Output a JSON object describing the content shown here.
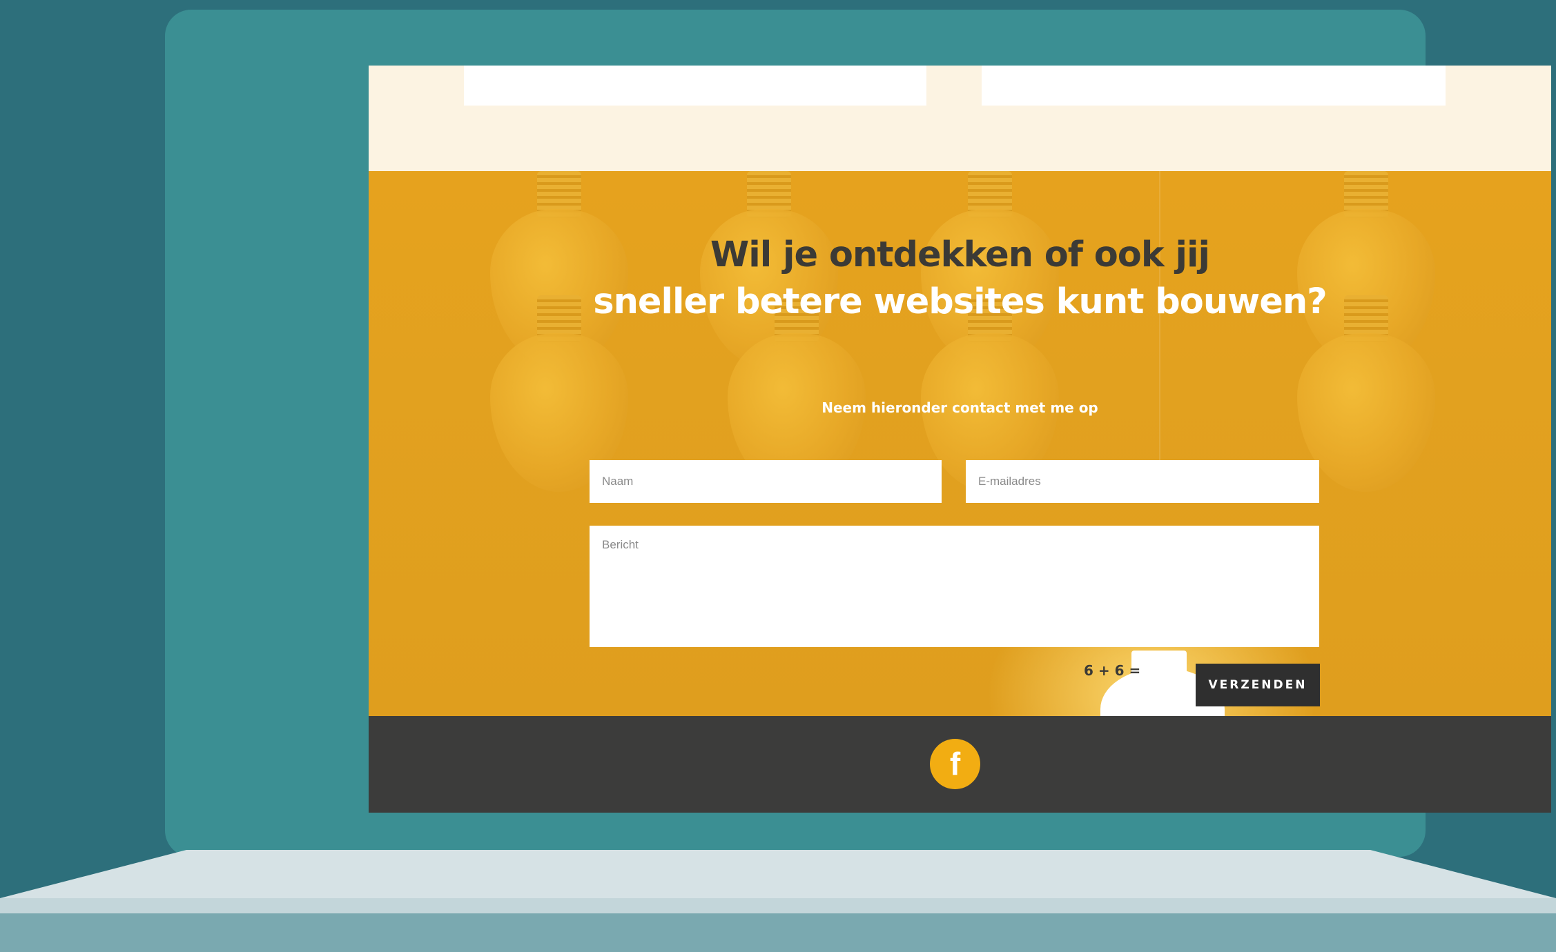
{
  "hero": {
    "headline_line1": "Wil je ontdekken of ook jij",
    "headline_line2": "sneller betere websites kunt bouwen?",
    "subheadline": "Neem hieronder contact met me op"
  },
  "form": {
    "name_placeholder": "Naam",
    "email_placeholder": "E-mailadres",
    "message_placeholder": "Bericht",
    "captcha_question": "6 + 6 =",
    "submit_label": "VERZENDEN"
  },
  "footer": {
    "social_icon": "facebook-icon",
    "social_glyph": "f"
  },
  "colors": {
    "background": "#2d6f7b",
    "laptop_frame": "#3b8f93",
    "hero_yellow": "#e3a11f",
    "footer_dark": "#3c3c3b",
    "facebook_accent": "#f2ad12",
    "button_dark": "#2f2f2f"
  }
}
